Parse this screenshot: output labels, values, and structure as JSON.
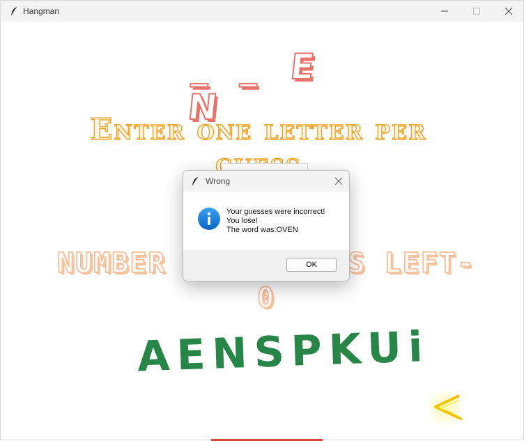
{
  "window": {
    "title": "Hangman",
    "minimize_icon": "minimize-icon",
    "maximize_icon": "maximize-icon",
    "close_icon": "close-icon"
  },
  "game": {
    "word_display": "_ _ E N",
    "instruction": "Enter one letter per guess",
    "guess_input_value": "",
    "guesses_left_label": "NUMBER OF GUESSES LEFT-",
    "guesses_left_value": "0",
    "used_letters": "AENSPKUi",
    "back_button_icon": "back-arrow-icon"
  },
  "dialog": {
    "title": "Wrong",
    "icon": "info-icon",
    "message_lines": [
      "Your guesses were incorrect!",
      "You lose!",
      "The word was:OVEN"
    ],
    "ok_label": "OK"
  },
  "colors": {
    "word": "#e8736b",
    "instruction": "#f2a52b",
    "guesses_left": "#f9c29e",
    "used_letters": "#268547",
    "back_glow": "#ffe600",
    "info_icon": "#1a7fd8"
  }
}
